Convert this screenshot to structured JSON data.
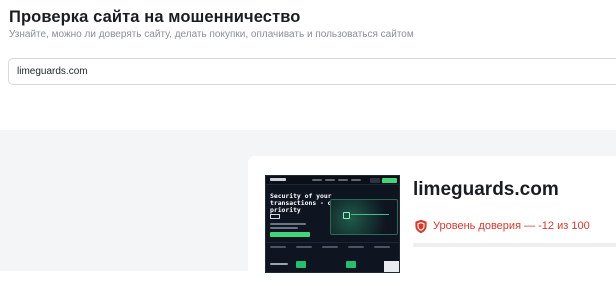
{
  "header": {
    "title": "Проверка сайта на мошенничество",
    "subtitle": "Узнайте, можно ли доверять сайту, делать покупки, оплачивать и пользоваться сайтом"
  },
  "search": {
    "value": "limeguards.com"
  },
  "result": {
    "domain": "limeguards.com",
    "trust_label": "Уровень доверия — -12 из 100",
    "trust_score": -12,
    "trust_max": 100,
    "status_color": "#d9382b",
    "status_icon": "shield-icon",
    "preview": {
      "headline": "Security of your\ntransactions - our\npriority",
      "accent_color": "#41d67a",
      "background_color": "#0e1420"
    }
  }
}
